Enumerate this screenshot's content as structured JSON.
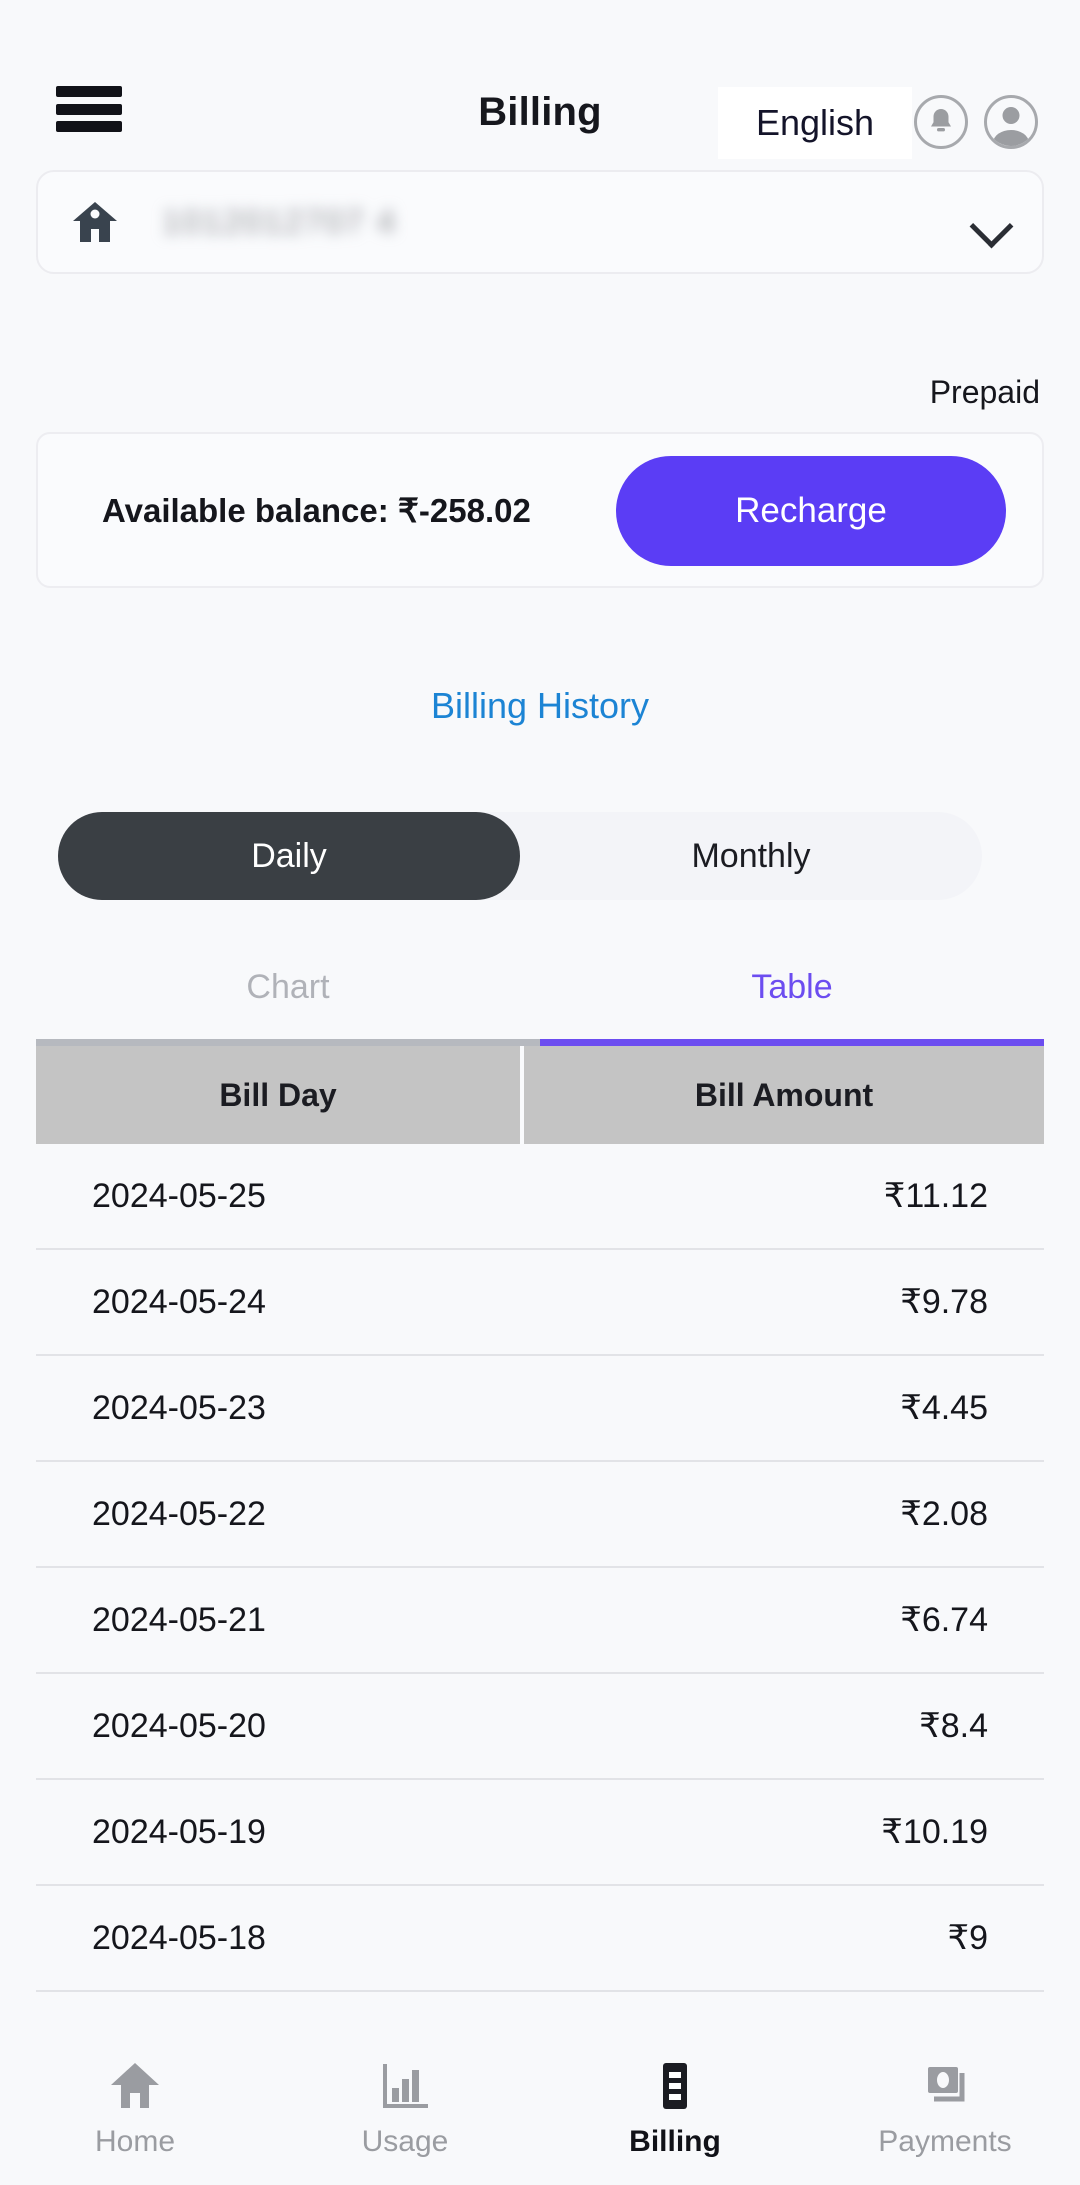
{
  "header": {
    "menu_icon": "hamburger-menu-icon",
    "title": "Billing",
    "language": "English",
    "notification_icon": "bell-icon",
    "profile_icon": "user-avatar-icon"
  },
  "account": {
    "home_icon": "home-icon",
    "number": "1012012707 4",
    "chevron_icon": "chevron-down-icon",
    "plan_type": "Prepaid"
  },
  "balance": {
    "label": "Available balance: ₹-258.02",
    "recharge_label": "Recharge",
    "recharge_color": "#5b3df5"
  },
  "links": {
    "billing_history": "Billing History",
    "billing_history_color": "#1c84d4"
  },
  "period_toggle": {
    "daily": "Daily",
    "monthly": "Monthly",
    "selected": "Daily",
    "active_bg": "#3a3f44"
  },
  "view_tabs": {
    "chart": "Chart",
    "table": "Table",
    "selected": "Table",
    "active_color": "#6c4df0",
    "inactive_color": "#b0b2b8"
  },
  "table": {
    "columns": [
      "Bill Day",
      "Bill Amount"
    ],
    "header_bg": "#c4c4c4",
    "rows": [
      {
        "day": "2024-05-25",
        "amount": "₹11.12"
      },
      {
        "day": "2024-05-24",
        "amount": "₹9.78"
      },
      {
        "day": "2024-05-23",
        "amount": "₹4.45"
      },
      {
        "day": "2024-05-22",
        "amount": "₹2.08"
      },
      {
        "day": "2024-05-21",
        "amount": "₹6.74"
      },
      {
        "day": "2024-05-20",
        "amount": "₹8.4"
      },
      {
        "day": "2024-05-19",
        "amount": "₹10.19"
      },
      {
        "day": "2024-05-18",
        "amount": "₹9"
      }
    ]
  },
  "bottom_nav": {
    "selected": "Billing",
    "items": [
      {
        "label": "Home",
        "icon": "home-icon"
      },
      {
        "label": "Usage",
        "icon": "bar-chart-icon"
      },
      {
        "label": "Billing",
        "icon": "invoice-icon"
      },
      {
        "label": "Payments",
        "icon": "money-icon"
      }
    ]
  }
}
